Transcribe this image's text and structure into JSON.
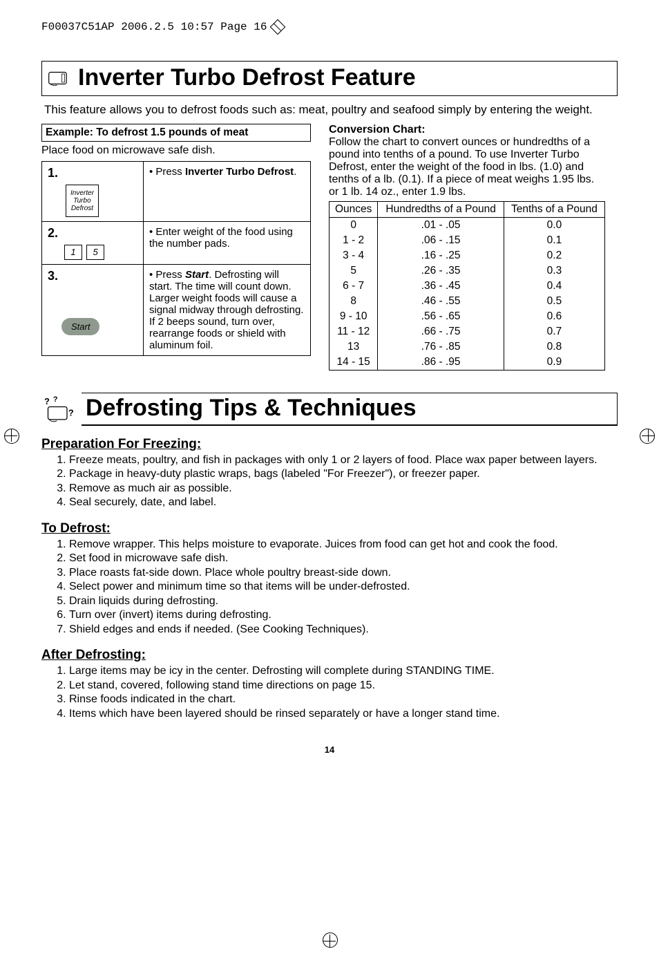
{
  "printhead": "F00037C51AP  2006.2.5  10:57  Page 16",
  "title1": "Inverter Turbo Defrost Feature",
  "intro": "This feature allows you to defrost foods such as: meat, poultry and seafood simply by entering the weight.",
  "example_title": "Example: To defrost 1.5 pounds of meat",
  "example_sub": "Place food on microwave safe dish.",
  "steps": [
    {
      "num": "1.",
      "button_label": "Inverter\nTurbo\nDefrost",
      "text_prefix": "• Press ",
      "text_bold": "Inverter Turbo Defrost",
      "text_suffix": "."
    },
    {
      "num": "2.",
      "pad_labels": [
        "1",
        "5"
      ],
      "text": "• Enter weight of the food using the number pads."
    },
    {
      "num": "3.",
      "button_label": "Start",
      "text_prefix": "• Press ",
      "text_bolditalic": "Start",
      "text_suffix": ". Defrosting will start. The time will count down. Larger weight foods will cause a signal midway through defrosting. If 2 beeps sound, turn over, rearrange foods or shield with aluminum foil."
    }
  ],
  "chart_title": "Conversion Chart:",
  "chart_desc": "Follow the chart to convert ounces or hundredths of a pound into tenths of a pound. To use Inverter Turbo Defrost, enter the weight of the food in lbs. (1.0) and tenths of a lb. (0.1). If a piece of meat weighs 1.95 lbs. or 1 lb. 14 oz., enter 1.9 lbs.",
  "chart_headers": [
    "Ounces",
    "Hundredths of a Pound",
    "Tenths of a Pound"
  ],
  "chart_rows": [
    [
      "0",
      ".01 - .05",
      "0.0"
    ],
    [
      "1 - 2",
      ".06 - .15",
      "0.1"
    ],
    [
      "3 - 4",
      ".16 - .25",
      "0.2"
    ],
    [
      "5",
      ".26 - .35",
      "0.3"
    ],
    [
      "6 - 7",
      ".36 - .45",
      "0.4"
    ],
    [
      "8",
      ".46 - .55",
      "0.5"
    ],
    [
      "9 - 10",
      ".56 - .65",
      "0.6"
    ],
    [
      "11 - 12",
      ".66 - .75",
      "0.7"
    ],
    [
      "13",
      ".76 - .85",
      "0.8"
    ],
    [
      "14 - 15",
      ".86 - .95",
      "0.9"
    ]
  ],
  "title2": "Defrosting Tips & Techniques",
  "prep_title": "Preparation For Freezing:",
  "prep_items": [
    "Freeze meats, poultry, and fish in packages with only 1 or 2 layers of food. Place wax paper between layers.",
    "Package in heavy-duty plastic wraps, bags (labeled \"For Freezer\"), or freezer paper.",
    "Remove as much air as possible.",
    "Seal securely, date, and label."
  ],
  "defrost_title": "To Defrost:",
  "defrost_items": [
    "Remove wrapper. This helps moisture to evaporate. Juices from food can get hot and cook the food.",
    "Set food in microwave safe dish.",
    "Place roasts fat-side down. Place whole poultry breast-side down.",
    "Select power and minimum time so that items will be under-defrosted.",
    "Drain liquids during defrosting.",
    "Turn over (invert) items during defrosting.",
    "Shield edges and ends if needed. (See Cooking Techniques)."
  ],
  "after_title": "After Defrosting:",
  "after_items": [
    "Large items may be icy in the center. Defrosting will complete during STANDING TIME.",
    "Let stand, covered, following stand time directions on page 15.",
    "Rinse foods indicated in the chart.",
    "Items which have been layered should be rinsed separately or have a longer stand time."
  ],
  "page_number": "14",
  "chart_data": {
    "type": "table",
    "title": "Conversion Chart",
    "columns": [
      "Ounces",
      "Hundredths of a Pound",
      "Tenths of a Pound"
    ],
    "rows": [
      [
        "0",
        ".01 - .05",
        "0.0"
      ],
      [
        "1 - 2",
        ".06 - .15",
        "0.1"
      ],
      [
        "3 - 4",
        ".16 - .25",
        "0.2"
      ],
      [
        "5",
        ".26 - .35",
        "0.3"
      ],
      [
        "6 - 7",
        ".36 - .45",
        "0.4"
      ],
      [
        "8",
        ".46 - .55",
        "0.5"
      ],
      [
        "9 - 10",
        ".56 - .65",
        "0.6"
      ],
      [
        "11 - 12",
        ".66 - .75",
        "0.7"
      ],
      [
        "13",
        ".76 - .85",
        "0.8"
      ],
      [
        "14 - 15",
        ".86 - .95",
        "0.9"
      ]
    ]
  }
}
